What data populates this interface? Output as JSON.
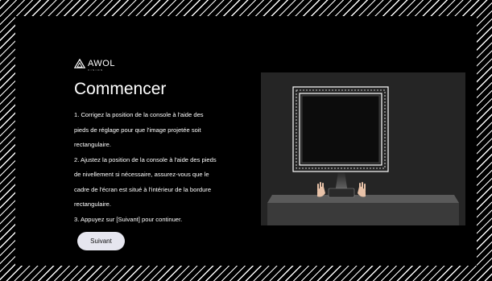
{
  "brand": {
    "name": "AWOL",
    "sub": "VISION"
  },
  "title": "Commencer",
  "instructions": [
    "1. Corrigez la position de la console à l'aide des",
    "pieds de réglage pour que l'image projetée soit",
    "rectangulaire.",
    "2. Ajustez la position de la console à l'aide des pieds",
    "de nivellement si nécessaire, assurez-vous que le",
    "cadre de l'écran est situé à l'intérieur de la bordure",
    "rectangulaire.",
    "3. Appuyez sur [Suivant] pour continuer."
  ],
  "next_button": "Suivant",
  "colors": {
    "background": "#000000",
    "button": "#e6e6ef",
    "illustration_bg": "#252525"
  }
}
